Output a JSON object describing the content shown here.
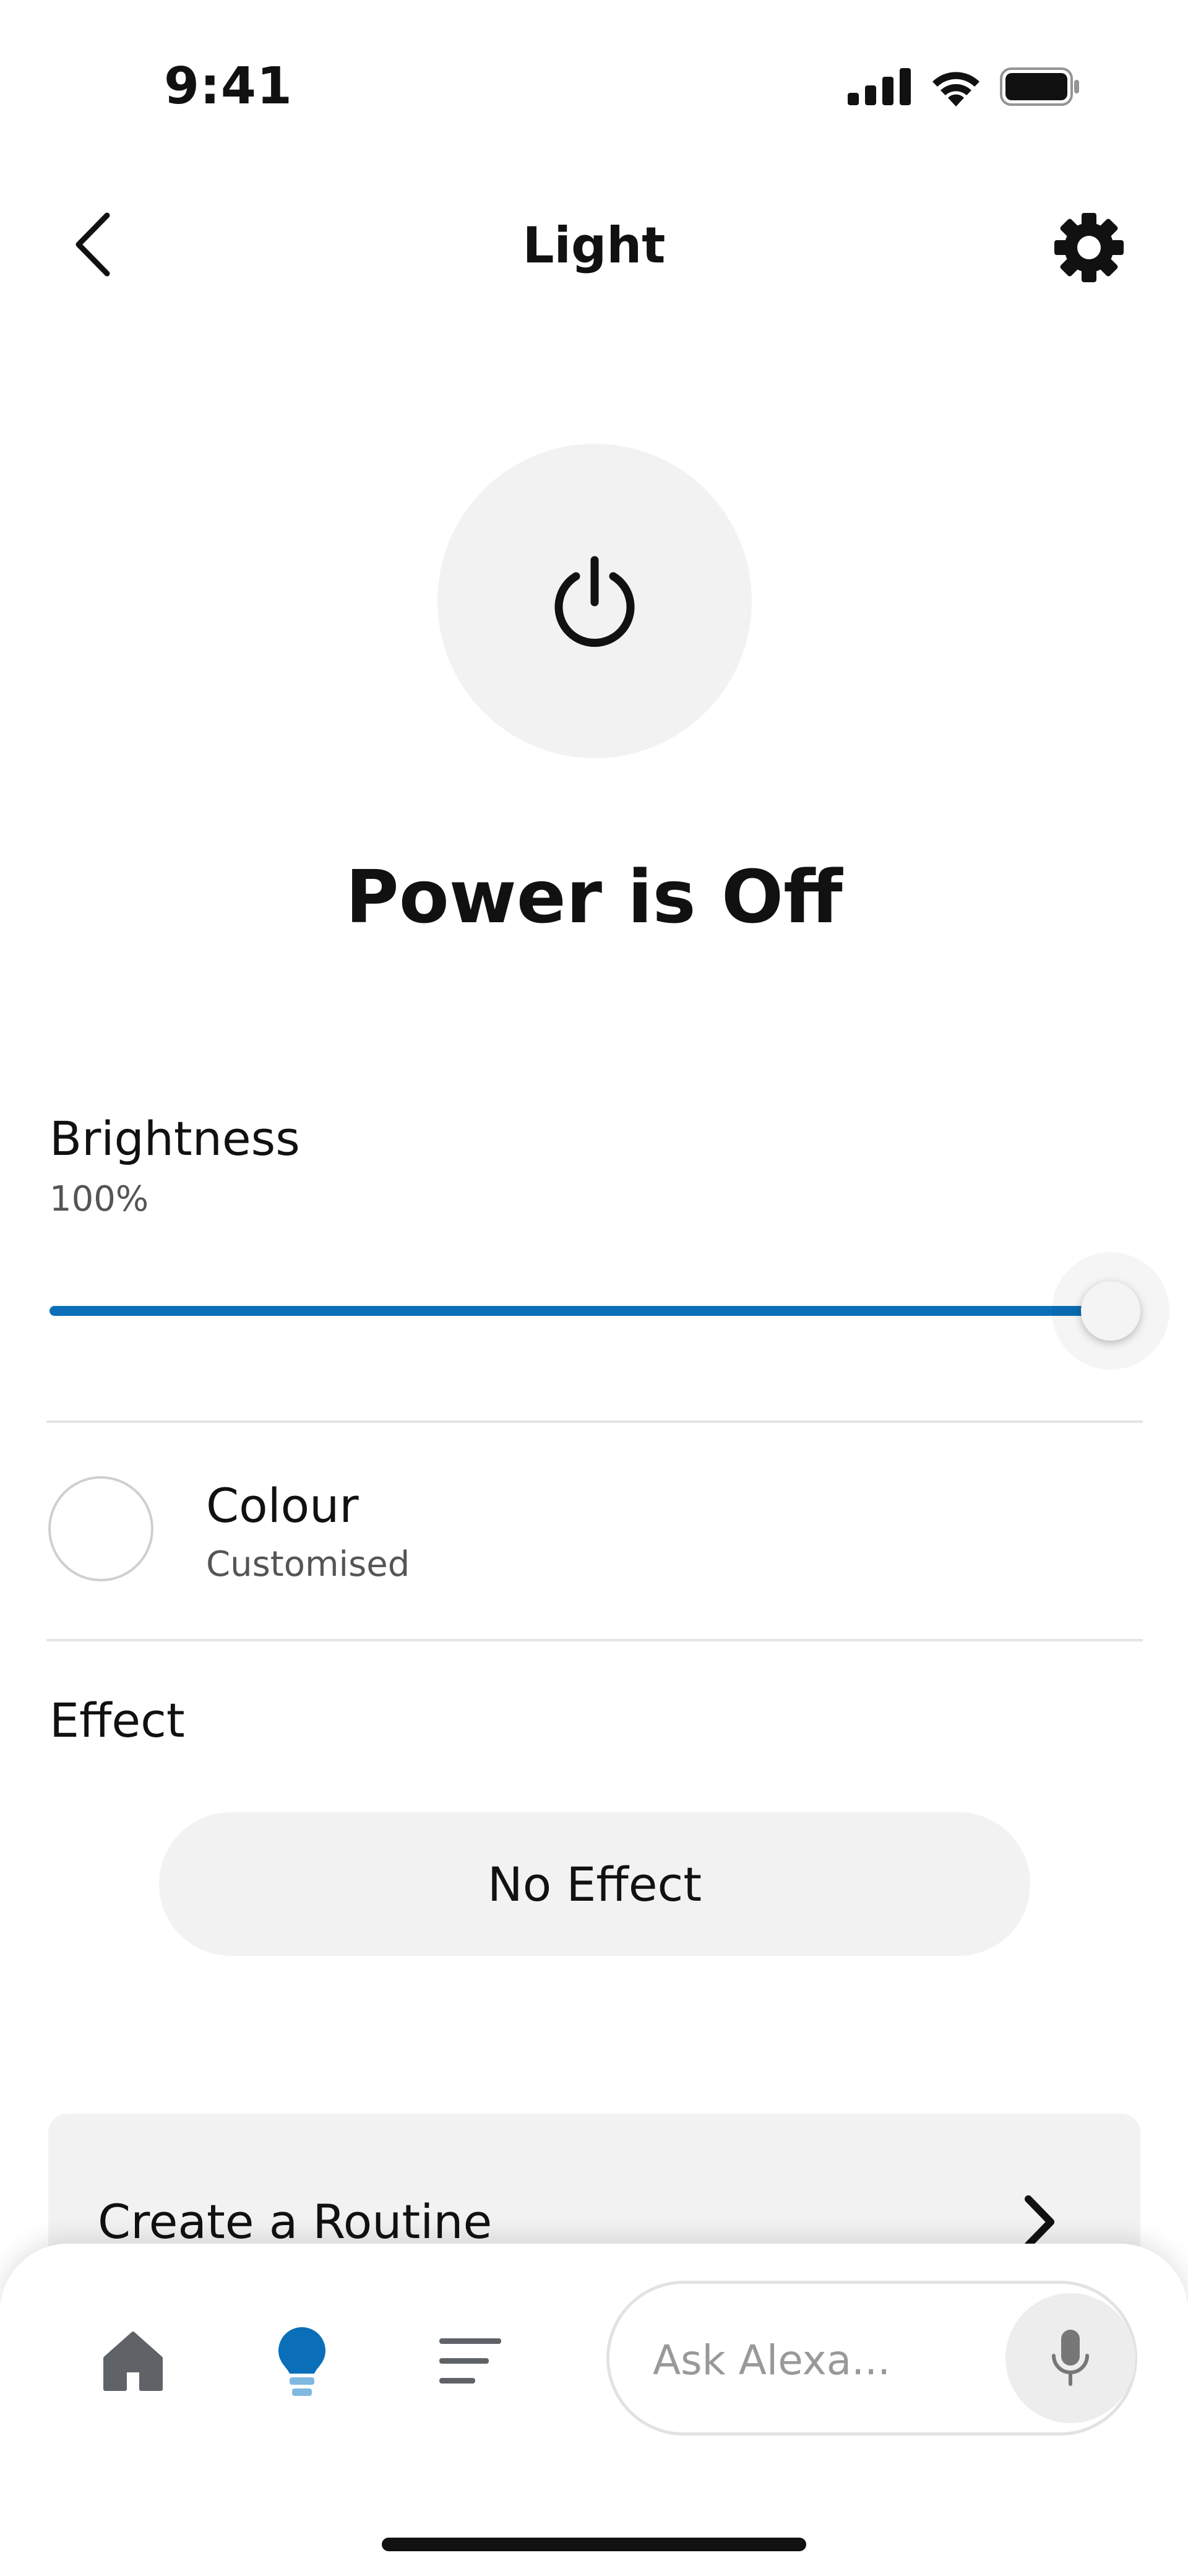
{
  "status_bar": {
    "time": "9:41",
    "icons": [
      "cellular-signal-icon",
      "wifi-icon",
      "battery-icon"
    ]
  },
  "header": {
    "title": "Light",
    "back_icon": "chevron-left-icon",
    "settings_icon": "gear-icon"
  },
  "power": {
    "icon": "power-icon",
    "status": "Power is Off"
  },
  "brightness": {
    "label": "Brightness",
    "value": "100%",
    "level": 1.0,
    "accent_color": "#0a6fb8"
  },
  "colour": {
    "label": "Colour",
    "value": "Customised"
  },
  "effect": {
    "label": "Effect",
    "value": "No Effect"
  },
  "routine": {
    "label": "Create a Routine",
    "icon": "chevron-right-icon"
  },
  "bottom_nav": {
    "tabs": [
      {
        "name": "home",
        "icon": "home-icon",
        "active": false
      },
      {
        "name": "devices",
        "icon": "lightbulb-icon",
        "active": true
      },
      {
        "name": "more",
        "icon": "menu-icon",
        "active": false
      }
    ],
    "ask_placeholder": "Ask Alexa...",
    "mic_icon": "microphone-icon"
  }
}
